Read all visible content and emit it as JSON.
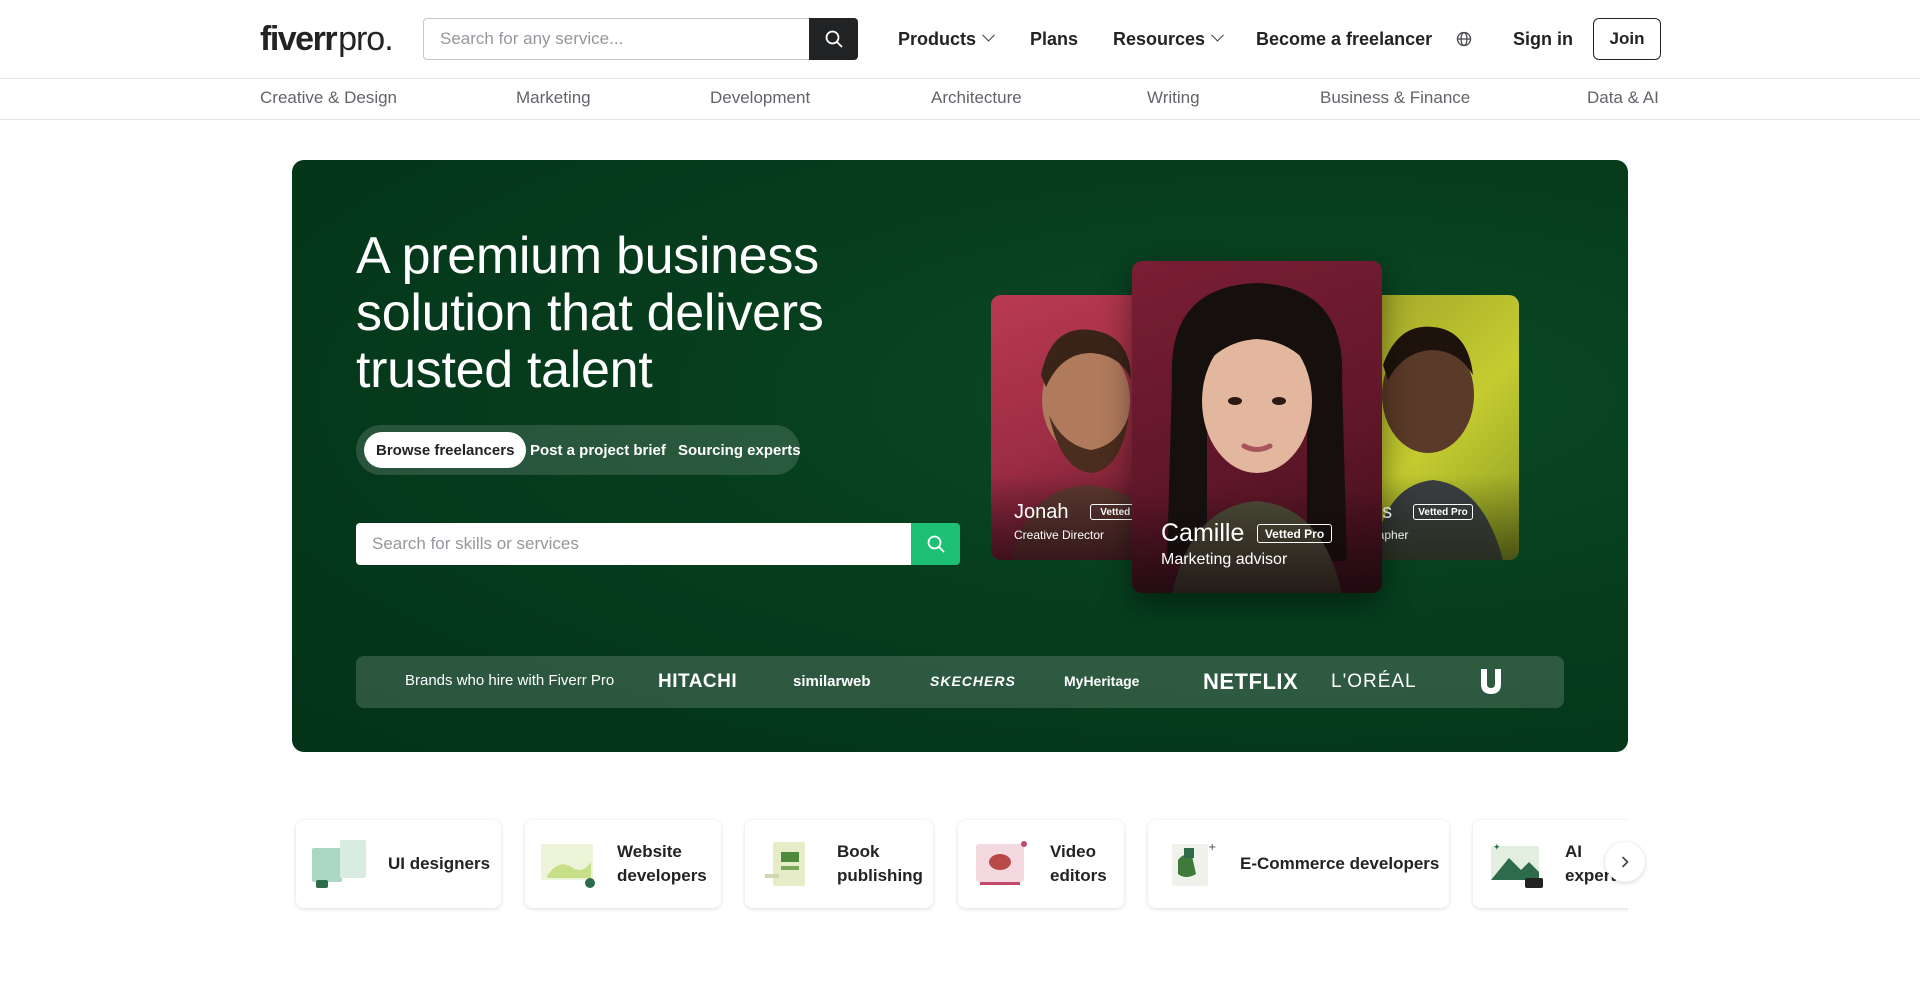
{
  "header": {
    "logo_brand": "fiverr",
    "logo_suffix": "pro.",
    "search_placeholder": "Search for any service...",
    "nav": {
      "products": "Products",
      "plans": "Plans",
      "resources": "Resources",
      "become_freelancer": "Become a freelancer",
      "sign_in": "Sign in",
      "join": "Join"
    }
  },
  "categories": [
    "Creative & Design",
    "Marketing",
    "Development",
    "Architecture",
    "Writing",
    "Business & Finance",
    "Data & AI"
  ],
  "hero": {
    "title": "A premium business solution that delivers trusted talent",
    "tabs": [
      "Browse freelancers",
      "Post a project brief",
      "Sourcing experts"
    ],
    "search_placeholder": "Search for skills or services",
    "cards": [
      {
        "name": "Jonah",
        "badge": "Vetted Pro",
        "role": "Creative Director"
      },
      {
        "name": "Camille",
        "badge": "Vetted Pro",
        "role": "Marketing advisor"
      },
      {
        "name": "es",
        "badge": "Vetted Pro",
        "role": "grapher"
      }
    ],
    "brands_label": "Brands who hire with Fiverr Pro",
    "brands": [
      "HITACHI",
      "similarweb",
      "SKECHERS",
      "MyHeritage",
      "NETFLIX",
      "L'ORÉAL",
      "Unilever"
    ]
  },
  "services": [
    {
      "label": "UI designers"
    },
    {
      "label": "Website developers"
    },
    {
      "label": "Book publishing"
    },
    {
      "label": "Video editors"
    },
    {
      "label": "E-Commerce developers"
    },
    {
      "label": "AI experts"
    }
  ],
  "colors": {
    "hero_bg": "#063d1d",
    "accent_green": "#1dbf73",
    "text_dark": "#222325"
  }
}
